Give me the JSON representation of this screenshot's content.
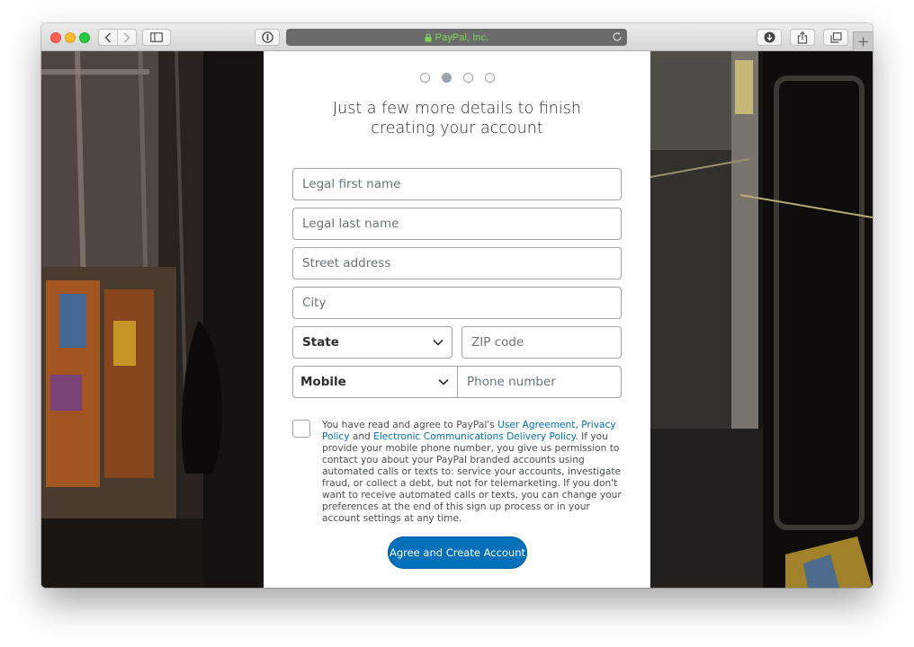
{
  "browser": {
    "address_text": "PayPal, Inc.",
    "icons": {
      "back": "chevron-left-icon",
      "forward": "chevron-right-icon",
      "sidebar": "sidebar-icon",
      "reader": "reader-info-icon",
      "lock": "lock-icon",
      "reload": "reload-icon",
      "downloads": "download-icon",
      "share": "share-icon",
      "tabs": "tabs-icon",
      "new_tab": "plus-icon"
    },
    "colors": {
      "address_text": "#7fd35b"
    }
  },
  "signup": {
    "step_total": 4,
    "step_current": 2,
    "heading": "Just a few more details to finish creating your account",
    "fields": {
      "first_name_placeholder": "Legal first name",
      "last_name_placeholder": "Legal last name",
      "street_placeholder": "Street address",
      "city_placeholder": "City",
      "state_label": "State",
      "zip_placeholder": "ZIP code",
      "phone_type_label": "Mobile",
      "phone_placeholder": "Phone number"
    },
    "legal": {
      "prefix": "You have read and agree to PayPal's ",
      "link_user_agreement": "User Agreement",
      "sep1": ", ",
      "link_privacy": "Privacy Policy",
      "sep2": " and ",
      "link_ecdp": "Electronic Communications Delivery Policy",
      "suffix": ". If you provide your mobile phone number, you give us permission to contact you about your PayPal branded accounts using automated calls or texts to: service your accounts, investigate fraud, or collect a debt, but not for telemarketing. If you don't want to receive automated calls or texts, you can change your preferences at the end of this sign up process or in your account settings at any time."
    },
    "cta_label": "Agree and Create Account",
    "colors": {
      "primary": "#0070ba",
      "link": "#0070ba"
    }
  }
}
